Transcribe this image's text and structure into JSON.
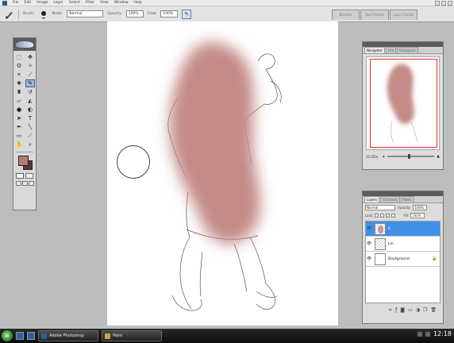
{
  "menubar": {
    "items": [
      "File",
      "Edit",
      "Image",
      "Layer",
      "Select",
      "Filter",
      "View",
      "Window",
      "Help"
    ]
  },
  "options": {
    "brush_label": "Brush:",
    "mode_label": "Mode:",
    "mode_value": "Normal",
    "opacity_label": "Opacity:",
    "opacity_value": "100%",
    "flow_label": "Flow:",
    "flow_value": "100%"
  },
  "palette_well": {
    "tabs": [
      "Brushes",
      "Tool Presets",
      "Layer Comps"
    ]
  },
  "toolbox": {
    "tools": [
      "marquee-icon",
      "move-icon",
      "lasso-icon",
      "magic-wand-icon",
      "crop-icon",
      "slice-icon",
      "healing-brush-icon",
      "brush-icon",
      "clone-stamp-icon",
      "history-brush-icon",
      "eraser-icon",
      "bucket-icon",
      "blur-icon",
      "dodge-icon",
      "path-select-icon",
      "type-icon",
      "pen-icon",
      "shape-icon",
      "notes-icon",
      "eyedropper-icon",
      "hand-icon",
      "zoom-icon"
    ],
    "active_tool": "brush-icon",
    "foreground_color": "#b57a77",
    "background_color": "#5a3a3a"
  },
  "navigator": {
    "tabs": [
      "Navigator",
      "Info",
      "Histogram"
    ],
    "zoom": "25.03%"
  },
  "layers": {
    "tabs": [
      "Layers",
      "Channels",
      "Paths"
    ],
    "blend_mode": "Normal",
    "opacity_label": "Opacity:",
    "opacity_value": "100%",
    "lock_label": "Lock:",
    "fill_label": "Fill:",
    "fill_value": "100%",
    "rows": [
      {
        "name": "b",
        "selected": true
      },
      {
        "name": "Lin",
        "selected": false
      },
      {
        "name": "Background",
        "selected": false
      }
    ]
  },
  "taskbar": {
    "tasks": [
      "Adobe Photoshop",
      "Paint"
    ],
    "clock": "12:18"
  }
}
